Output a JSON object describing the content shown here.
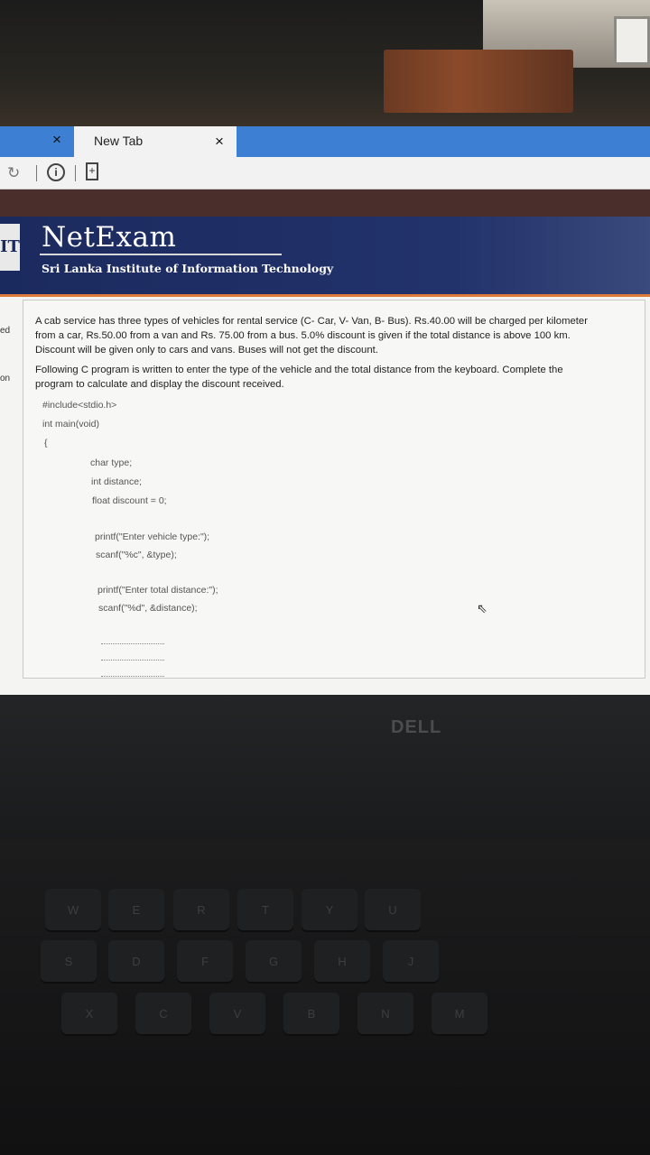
{
  "browser": {
    "tab_title": "New Tab",
    "close_glyph": "×",
    "icons": [
      "reload-icon",
      "info-icon",
      "page-icon"
    ]
  },
  "site": {
    "brand": "NetExam",
    "institute": "Sri Lanka Institute of Information Technology",
    "logo_text": "IT"
  },
  "side_labels": [
    "ed",
    "on"
  ],
  "question": {
    "para1_line1": "A cab service has three types of vehicles for rental service (C- Car, V- Van, B- Bus). Rs.40.00 will be charged per kilometer",
    "para1_line2": "from a car, Rs.50.00 from a van and  Rs. 75.00 from a bus.  5.0% discount is given if the total distance is above 100 km.",
    "para1_line3": "Discount will be given only to cars and vans. Buses will not get the discount.",
    "para2_line1": "Following C program is written to enter the type of the vehicle and the total distance from the keyboard. Complete the",
    "para2_line2": "program to calculate and display the discount received.",
    "code": [
      "#include<stdio.h>",
      "int main(void)",
      "{",
      "char type;",
      "int distance;",
      "float discount = 0;",
      "printf(\"Enter vehicle type:\");",
      "scanf(\"%c\", &type);",
      "printf(\"Enter total distance:\");",
      "scanf(\"%d\", &distance);"
    ]
  },
  "laptop": {
    "brand": "DELL",
    "keys_row1": [
      "W",
      "E",
      "R",
      "T",
      "Y",
      "U"
    ],
    "keys_row2": [
      "S",
      "D",
      "F",
      "G",
      "H",
      "J"
    ],
    "keys_row3": [
      "X",
      "C",
      "V",
      "B",
      "N",
      "M"
    ]
  }
}
